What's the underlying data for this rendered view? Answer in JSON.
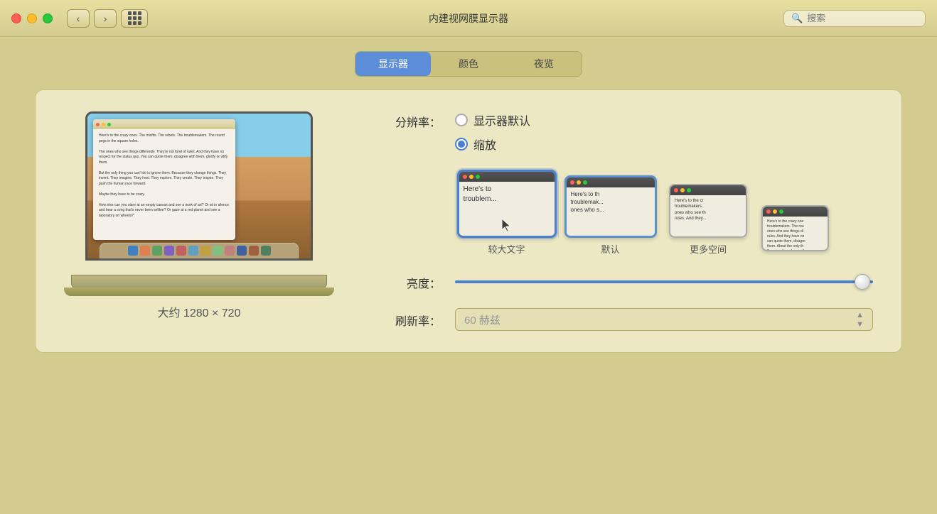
{
  "titlebar": {
    "title": "内建视网膜显示器",
    "search_placeholder": "搜索"
  },
  "tabs": [
    {
      "id": "display",
      "label": "显示器",
      "active": true
    },
    {
      "id": "color",
      "label": "颜色",
      "active": false
    },
    {
      "id": "nightshift",
      "label": "夜览",
      "active": false
    }
  ],
  "resolution": {
    "label": "分辨率：",
    "options": [
      {
        "id": "default",
        "label": "显示器默认",
        "selected": false
      },
      {
        "id": "scaled",
        "label": "缩放",
        "selected": true
      }
    ]
  },
  "thumbnails": [
    {
      "id": "large-text",
      "label": "较大文字",
      "selected": true,
      "size": "large",
      "text": "Here's to\ntroubl..."
    },
    {
      "id": "default",
      "label": "默认",
      "selected": false,
      "size": "medium",
      "text": "Here's to th\ntroublemakers\nones who..."
    },
    {
      "id": "more-space",
      "label": "更多空间",
      "selected": false,
      "size": "smaller",
      "text": "Here's to the crazy one\ntroublemak..."
    }
  ],
  "resolution_display": {
    "label": "大约 1280 × 720"
  },
  "brightness": {
    "label": "亮度：",
    "value": 95
  },
  "refresh_rate": {
    "label": "刷新率：",
    "value": "60 赫兹"
  },
  "screen_content": {
    "paragraph1": "Here's to the crazy ones. The misfits. The rebels. The troublemakers. The round pegs in the square holes.",
    "paragraph2": "The ones who see things differently. They're not fond of rules. And they have no respect for the status quo. You can quote them, disagree with them, glorify or vilify them.",
    "paragraph3": "But the only thing you can't do is ignore them. Because they change things. They invent. They imagine. They heal. They explore. They create. They inspire. They push the human race forward.",
    "paragraph4": "Maybe they have to be crazy.",
    "paragraph5": "How else can you stare at an empty canvas and see a work of art? Or sit in silence and hear a song that's never been written? Or gaze at a red planet and see a laboratory on wheels?"
  },
  "icons": {
    "close": "●",
    "minimize": "●",
    "maximize": "●",
    "back": "‹",
    "forward": "›",
    "search": "🔍"
  }
}
